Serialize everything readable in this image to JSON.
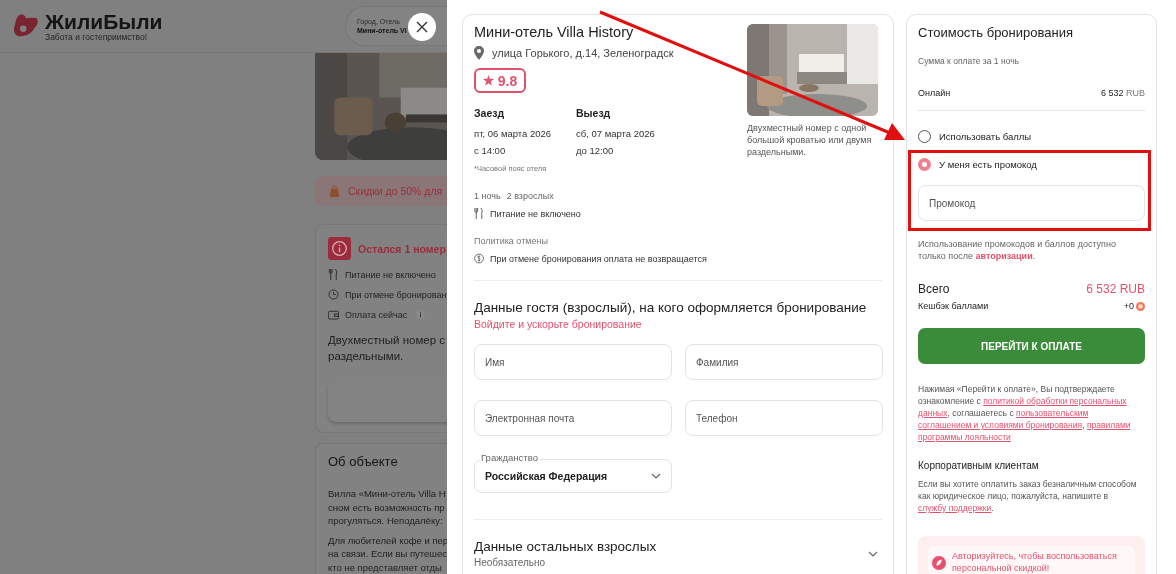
{
  "background_page": {
    "logo": {
      "name": "ЖилиБыли",
      "tagline": "Забота и гостеприимство!"
    },
    "search": {
      "label": "Город, Отель",
      "value": "Мини-отель Vi"
    },
    "promo_banner": "Скидки до 50% для",
    "room_card": {
      "alert": "Остался 1 номер",
      "features": [
        {
          "kind": "meal",
          "text": "Питание не включено"
        },
        {
          "kind": "cancel",
          "text": "При отмене бронирован"
        },
        {
          "kind": "payment",
          "text": "Оплата сейчас"
        }
      ],
      "description_lines": [
        "Двухместный номер с",
        "раздельными."
      ]
    },
    "about": {
      "title": "Об объекте",
      "paragraphs": [
        [
          "Вилла «Мини-отель Villa H",
          "сном есть возможность пр",
          "прогуляться. Неподалёку:"
        ],
        [
          "Для любителей кофе и пер",
          "на связи. Если вы путешес",
          "кто не представляет отды"
        ]
      ]
    }
  },
  "modal": {
    "hotel": {
      "name": "Мини-отель Villa History",
      "address": "улица Горького, д.14, Зеленоградск",
      "rating": "9.8",
      "checkin": {
        "label": "Заезд",
        "date": "пт, 06 марта 2026",
        "time": "с 14:00"
      },
      "checkout": {
        "label": "Выезд",
        "date": "сб, 07 марта 2026",
        "time": "до 12:00"
      },
      "timezone_note": "*Часовой пояс отеля",
      "nights": "1 ночь",
      "guests": "2 взрослых",
      "meal": "Питание не включено",
      "policy_label": "Политика отмены",
      "policy": "При отмене бронирования оплата не возвращается",
      "room_description": "Двухместный номер с одной большой кроватью или двумя раздельными."
    },
    "guest_form": {
      "title": "Данные гостя (взрослый), на кого оформляется бронирование",
      "login_link": "Войдите и ускорьте бронирование",
      "fields": [
        {
          "placeholder": "Имя"
        },
        {
          "placeholder": "Фамилия"
        },
        {
          "placeholder": "Электронная почта"
        },
        {
          "placeholder": "Телефон"
        }
      ],
      "citizenship": {
        "label": "Гражданство",
        "value": "Российская Федерация"
      },
      "other_adults": {
        "title": "Данные остальных взрослых",
        "subtitle": "Необязательно",
        "expanded": false
      }
    },
    "price": {
      "title": "Стоимость бронирования",
      "subtitle": "Сумма к оплате за 1 ночь",
      "online": {
        "label": "Онлайн",
        "amount": "6 532",
        "currency": "RUB"
      },
      "options": [
        {
          "label": "Использовать баллы",
          "selected": false
        },
        {
          "label": "У меня есть промокод",
          "selected": true
        }
      ],
      "promo_field": {
        "placeholder": "Промокод"
      },
      "note": [
        {
          "kind": "text",
          "text": "Использование промокодов и баллов доступно только после"
        },
        {
          "kind": "link",
          "text": "авторизации"
        },
        {
          "kind": "text",
          "text": "."
        }
      ],
      "total": {
        "label": "Всего",
        "amount": "6 532 RUB"
      },
      "cashback": {
        "label": "Кешбэк баллами",
        "value": "+0"
      },
      "pay_button": "ПЕРЕЙТИ К ОПЛАТЕ",
      "consent": [
        {
          "kind": "text",
          "text": "Нажимая «Перейти к оплате», Вы подтверждаете ознакомление с"
        },
        {
          "kind": "link",
          "text": "политикой обработки персональных"
        },
        {
          "kind": "link",
          "text": "данных"
        },
        {
          "kind": "text",
          "text": ", соглашаетесь с"
        },
        {
          "kind": "link",
          "text": "пользовательским"
        },
        {
          "kind": "link",
          "text": "соглашением и условиями бронирования"
        },
        {
          "kind": "text",
          "text": ","
        },
        {
          "kind": "link",
          "text": "правилами"
        },
        {
          "kind": "link",
          "text": "программы лояльности"
        }
      ],
      "corporate_title": "Корпоративным клиентам",
      "corporate": [
        {
          "kind": "text",
          "text": "Если вы хотите оплатить заказ безналичным способом как юридическое лицо, пожалуйста, напишите в"
        },
        {
          "kind": "link",
          "text": "службу поддержки"
        },
        {
          "kind": "text",
          "text": "."
        }
      ],
      "auth_banner": "Авторизуйтесь, чтобы воспользоваться персональной скидкой!"
    }
  }
}
